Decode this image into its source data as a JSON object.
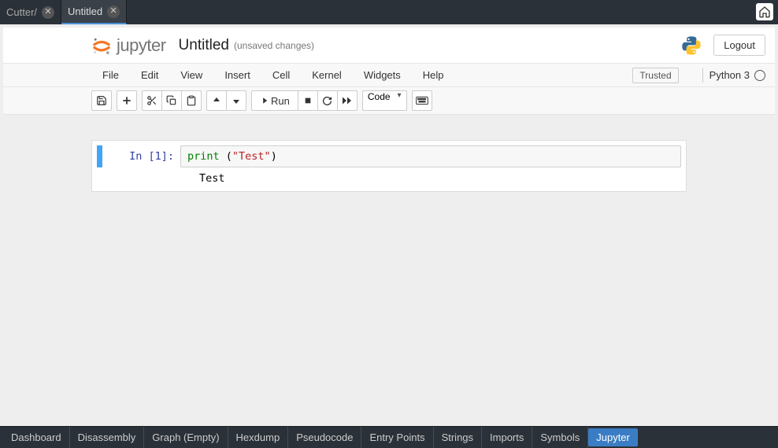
{
  "top_tabs": [
    {
      "label": "Cutter/",
      "active": false
    },
    {
      "label": "Untitled",
      "active": true
    }
  ],
  "header": {
    "logo_text": "jupyter",
    "title": "Untitled",
    "status": "(unsaved changes)",
    "logout": "Logout"
  },
  "menu": {
    "items": [
      "File",
      "Edit",
      "View",
      "Insert",
      "Cell",
      "Kernel",
      "Widgets",
      "Help"
    ],
    "trusted": "Trusted",
    "kernel": "Python 3"
  },
  "toolbar": {
    "run_label": "Run",
    "cell_type": "Code"
  },
  "cell": {
    "prompt": "In [1]:",
    "code_fn": "print",
    "code_space": " (",
    "code_str": "\"Test\"",
    "code_end": ")",
    "output": "Test"
  },
  "bottom_tabs": [
    "Dashboard",
    "Disassembly",
    "Graph (Empty)",
    "Hexdump",
    "Pseudocode",
    "Entry Points",
    "Strings",
    "Imports",
    "Symbols",
    "Jupyter"
  ],
  "bottom_active": 9
}
